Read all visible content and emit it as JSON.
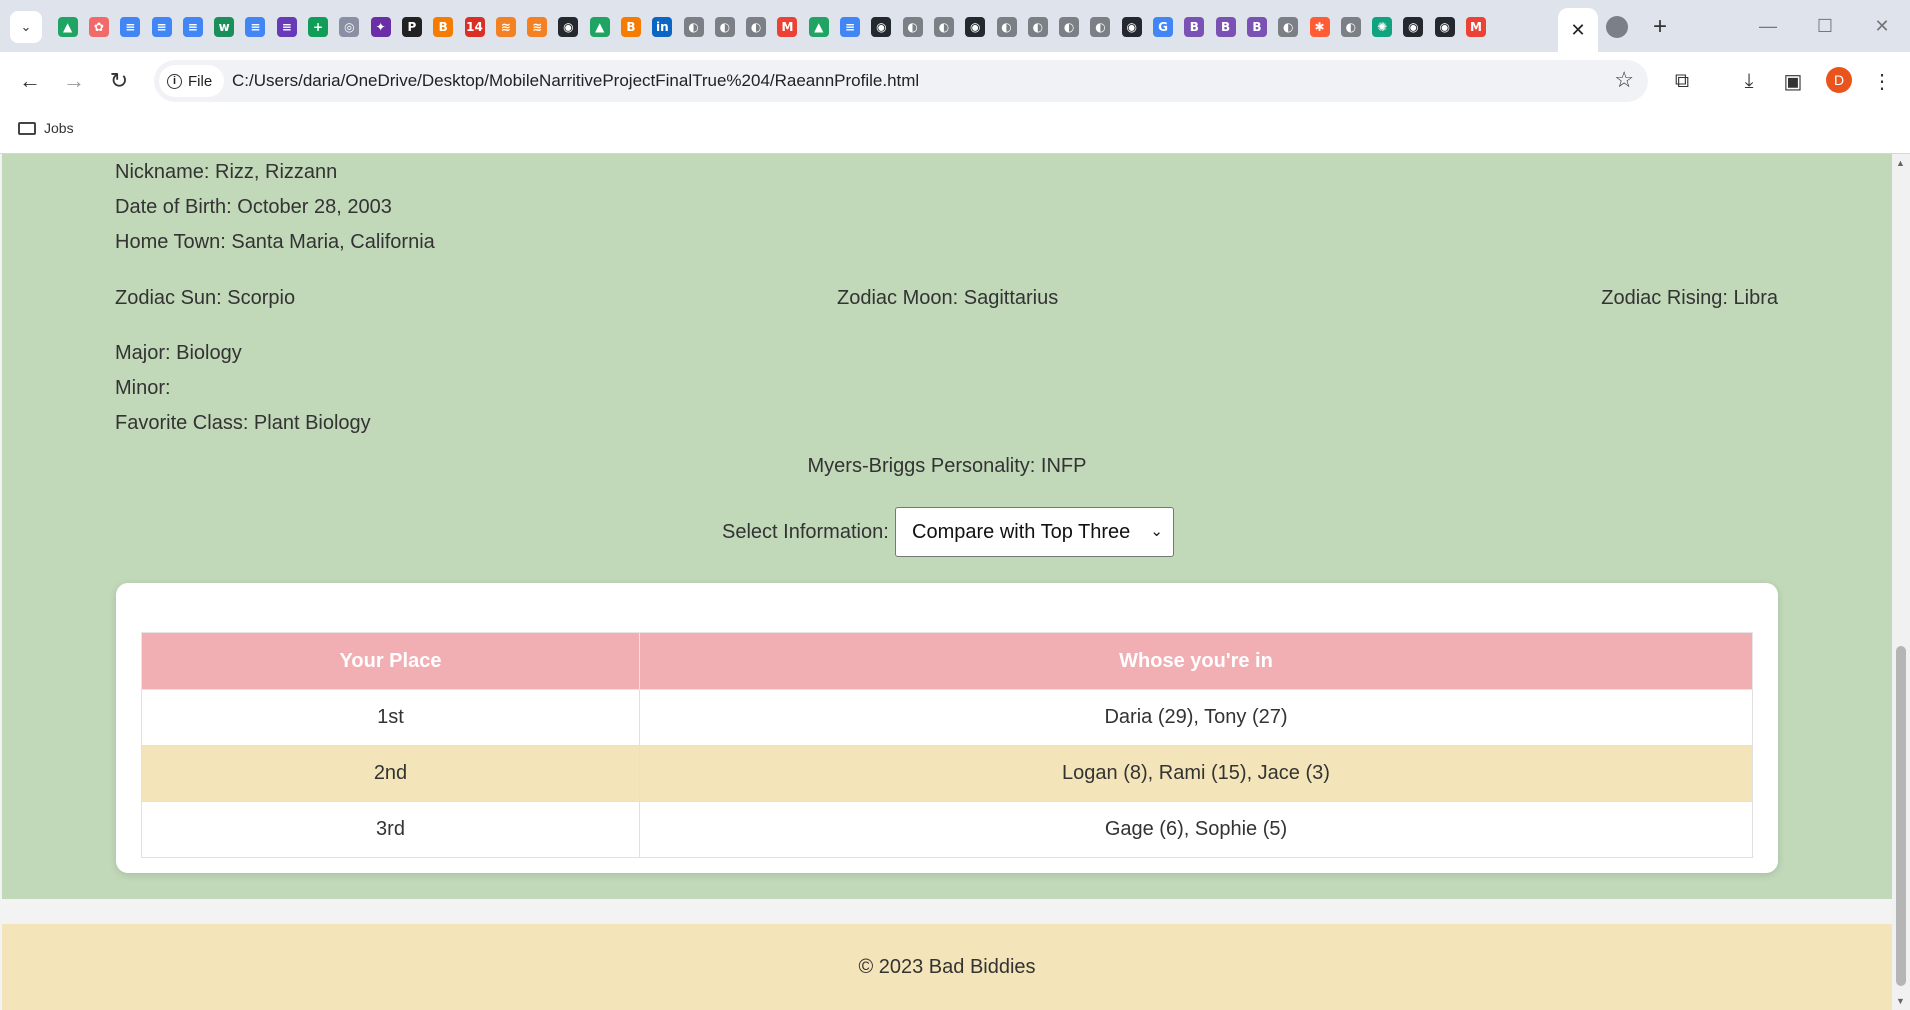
{
  "browser": {
    "active_tab_close": "✕",
    "new_tab": "+",
    "omnibox_chip": "File",
    "url": "C:/Users/daria/OneDrive/Desktop/MobileNarritiveProjectFinalTrue%204/RaeannProfile.html",
    "avatar_letter": "D",
    "bookmark": "Jobs",
    "favicons": [
      {
        "icon": "drive-icon",
        "color": "#1fa463",
        "glyph": "▲"
      },
      {
        "icon": "asana-icon",
        "color": "#f06a6a",
        "glyph": "✿"
      },
      {
        "icon": "docs-icon",
        "color": "#4285f4",
        "glyph": "≡"
      },
      {
        "icon": "docs-icon",
        "color": "#4285f4",
        "glyph": "≡"
      },
      {
        "icon": "docs-icon",
        "color": "#4285f4",
        "glyph": "≡"
      },
      {
        "icon": "wordtune-icon",
        "color": "#1a8f5a",
        "glyph": "w"
      },
      {
        "icon": "docs-icon",
        "color": "#4285f4",
        "glyph": "≡"
      },
      {
        "icon": "forms-icon",
        "color": "#673ab7",
        "glyph": "≡"
      },
      {
        "icon": "sheets-icon",
        "color": "#0f9d58",
        "glyph": "+"
      },
      {
        "icon": "target-icon",
        "color": "#8a8fa3",
        "glyph": "◎"
      },
      {
        "icon": "sparkle-icon",
        "color": "#6a2ea6",
        "glyph": "✦"
      },
      {
        "icon": "p-icon",
        "color": "#222222",
        "glyph": "P"
      },
      {
        "icon": "blogger-icon",
        "color": "#f57c00",
        "glyph": "B"
      },
      {
        "icon": "calendar-icon",
        "color": "#d93025",
        "glyph": "14"
      },
      {
        "icon": "stackoverflow-icon",
        "color": "#f48024",
        "glyph": "≋"
      },
      {
        "icon": "stackoverflow-icon",
        "color": "#f48024",
        "glyph": "≋"
      },
      {
        "icon": "github-icon",
        "color": "#24292f",
        "glyph": "◉"
      },
      {
        "icon": "drive-icon",
        "color": "#1fa463",
        "glyph": "▲"
      },
      {
        "icon": "blogger-icon",
        "color": "#f57c00",
        "glyph": "B"
      },
      {
        "icon": "linkedin-icon",
        "color": "#0a66c2",
        "glyph": "in"
      },
      {
        "icon": "globe-icon",
        "color": "#7b7f86",
        "glyph": "◐"
      },
      {
        "icon": "globe-icon",
        "color": "#7b7f86",
        "glyph": "◐"
      },
      {
        "icon": "globe-icon",
        "color": "#7b7f86",
        "glyph": "◐"
      },
      {
        "icon": "gmail-icon",
        "color": "#ea4335",
        "glyph": "M"
      },
      {
        "icon": "drive-icon",
        "color": "#1fa463",
        "glyph": "▲"
      },
      {
        "icon": "docs-icon",
        "color": "#4285f4",
        "glyph": "≡"
      },
      {
        "icon": "github-icon",
        "color": "#24292f",
        "glyph": "◉"
      },
      {
        "icon": "globe-icon",
        "color": "#7b7f86",
        "glyph": "◐"
      },
      {
        "icon": "globe-icon",
        "color": "#7b7f86",
        "glyph": "◐"
      },
      {
        "icon": "github-icon",
        "color": "#24292f",
        "glyph": "◉"
      },
      {
        "icon": "globe-icon",
        "color": "#7b7f86",
        "glyph": "◐"
      },
      {
        "icon": "globe-icon",
        "color": "#7b7f86",
        "glyph": "◐"
      },
      {
        "icon": "globe-icon",
        "color": "#7b7f86",
        "glyph": "◐"
      },
      {
        "icon": "globe-icon",
        "color": "#7b7f86",
        "glyph": "◐"
      },
      {
        "icon": "github-icon",
        "color": "#24292f",
        "glyph": "◉"
      },
      {
        "icon": "google-icon",
        "color": "#4285f4",
        "glyph": "G"
      },
      {
        "icon": "bootstrap-icon",
        "color": "#7952b3",
        "glyph": "B"
      },
      {
        "icon": "bootstrap-icon",
        "color": "#7952b3",
        "glyph": "B"
      },
      {
        "icon": "bootstrap-icon",
        "color": "#7952b3",
        "glyph": "B"
      },
      {
        "icon": "globe-icon",
        "color": "#7b7f86",
        "glyph": "◐"
      },
      {
        "icon": "hubspot-icon",
        "color": "#ff5c35",
        "glyph": "✱"
      },
      {
        "icon": "globe-icon",
        "color": "#7b7f86",
        "glyph": "◐"
      },
      {
        "icon": "chatgpt-icon",
        "color": "#10a37f",
        "glyph": "✺"
      },
      {
        "icon": "github-icon",
        "color": "#24292f",
        "glyph": "◉"
      },
      {
        "icon": "github-icon",
        "color": "#24292f",
        "glyph": "◉"
      },
      {
        "icon": "gmail-icon",
        "color": "#ea4335",
        "glyph": "M"
      }
    ]
  },
  "profile": {
    "nickname": "Nickname: Rizz, Rizzann",
    "dob": "Date of Birth: October 28, 2003",
    "hometown": "Home Town: Santa Maria, California",
    "zodiac_sun": "Zodiac Sun: Scorpio",
    "zodiac_moon": "Zodiac Moon: Sagittarius",
    "zodiac_rising": "Zodiac Rising: Libra",
    "major": "Major: Biology",
    "minor": "Minor:",
    "favorite_class": "Favorite Class: Plant Biology",
    "mbti": "Myers-Briggs Personality: INFP"
  },
  "select": {
    "label": "Select Information:",
    "value": "Compare with Top Three"
  },
  "table": {
    "headers": [
      "Your Place",
      "Whose you're in"
    ],
    "rows": [
      [
        "1st",
        "Daria (29), Tony (27)"
      ],
      [
        "2nd",
        "Logan (8), Rami (15), Jace (3)"
      ],
      [
        "3rd",
        "Gage (6), Sophie (5)"
      ]
    ]
  },
  "footer": {
    "text": "© 2023 Bad Biddies"
  },
  "colors": {
    "page_bg": "#c1d8b9",
    "table_header": "#f1aeb3",
    "alt_row": "#f3e5b9",
    "footer_bg": "#f3e5b9"
  }
}
